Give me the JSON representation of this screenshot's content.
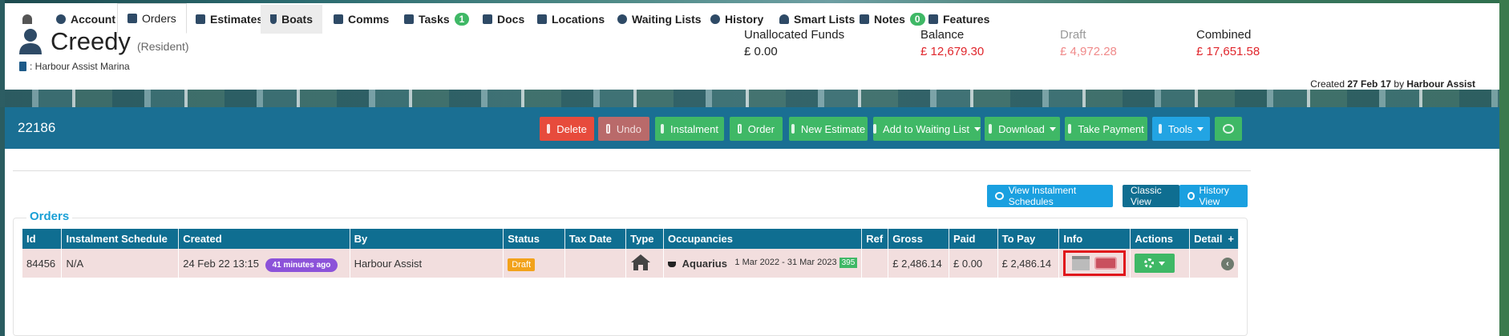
{
  "header": {
    "name": "Creedy",
    "role": "(Resident)",
    "marina": ": Harbour Assist Marina",
    "funds": [
      {
        "label": "Unallocated Funds",
        "value": "£ 0.00",
        "color": "#222222"
      },
      {
        "label": "Balance",
        "value": "£ 12,679.30",
        "color": "#e0262c"
      },
      {
        "label": "Draft",
        "value": "£ 4,972.28",
        "color": "#f08a8a"
      },
      {
        "label": "Combined",
        "value": "£ 17,651.58",
        "color": "#e0262c"
      }
    ],
    "created_prefix": "Created",
    "created_date": "27 Feb 17",
    "created_by_word": "by",
    "created_by": "Harbour Assist"
  },
  "toolbar": {
    "record_id": "22186",
    "delete": "Delete",
    "undo": "Undo",
    "instalment": "Instalment",
    "order": "Order",
    "new_estimate": "New Estimate",
    "waiting_list": "Add to Waiting List",
    "download": "Download",
    "take_payment": "Take Payment",
    "tools": "Tools"
  },
  "tabs": {
    "account": "Account",
    "orders": "Orders",
    "estimates": "Estimates",
    "boats": "Boats",
    "comms": "Comms",
    "tasks": "Tasks",
    "tasks_count": "1",
    "docs": "Docs",
    "locations": "Locations",
    "waiting_lists": "Waiting Lists",
    "history": "History",
    "smart_lists": "Smart Lists",
    "notes": "Notes",
    "notes_count": "0",
    "features": "Features"
  },
  "views": {
    "instalment_schedules": "View Instalment Schedules",
    "classic": "Classic View",
    "history": "History View"
  },
  "orders": {
    "title": "Orders",
    "columns": [
      "Id",
      "Instalment Schedule",
      "Created",
      "By",
      "Status",
      "Tax Date",
      "Type",
      "Occupancies",
      "Ref",
      "Gross",
      "Paid",
      "To Pay",
      "Info",
      "Actions",
      "Detail"
    ],
    "add_symbol": "+",
    "rows": [
      {
        "id": "84456",
        "schedule": "N/A",
        "created": "24 Feb 22 13:15",
        "ago": "41 minutes ago",
        "by": "Harbour Assist",
        "status": "Draft",
        "tax_date": "",
        "type_icon": "house-icon",
        "occupancy_name": "Aquarius",
        "occupancy_dates": "1 Mar 2022 - 31 Mar 2023",
        "occupancy_days": "395",
        "ref": "",
        "gross": "£ 2,486.14",
        "paid": "£ 0.00",
        "to_pay": "£ 2,486.14"
      }
    ]
  }
}
